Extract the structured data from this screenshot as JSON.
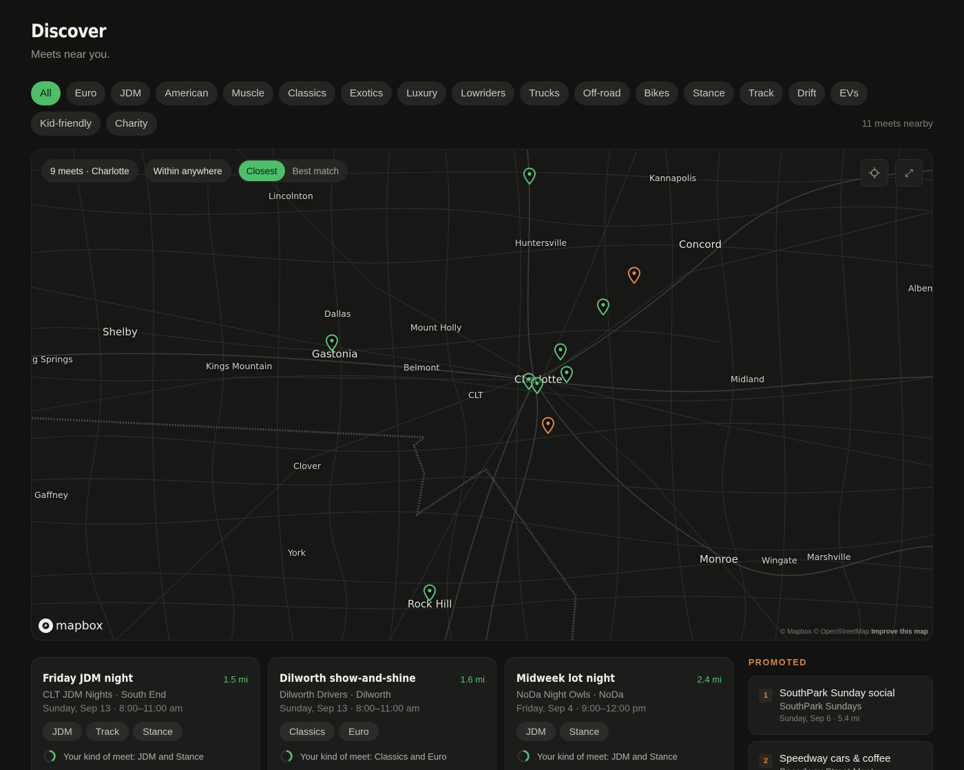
{
  "header": {
    "title": "Discover",
    "subtitle": "Meets near you."
  },
  "filters": {
    "row1": [
      "All",
      "Euro",
      "JDM",
      "American",
      "Muscle",
      "Classics",
      "Exotics",
      "Luxury",
      "Lowriders",
      "Trucks",
      "Off-road",
      "Bikes",
      "Stance",
      "Track",
      "Drift",
      "EVs"
    ],
    "row2": [
      "Kid-friendly",
      "Charity"
    ],
    "active": "All",
    "meets_nearby": "11 meets nearby"
  },
  "map": {
    "location_pill": "9 meets · Charlotte",
    "radius_pill": "Within anywhere",
    "sort_closest": "Closest",
    "sort_best": "Best match",
    "sort_active": "Closest",
    "locate_icon": "crosshair-icon",
    "expand_icon": "expand-icon",
    "logo_text": "mapbox",
    "attribution": "© Mapbox © OpenStreetMap",
    "attribution_link": "Improve this map",
    "colors": {
      "pin_green": "#5ac474",
      "pin_orange": "#e08a3c"
    },
    "cities": {
      "kannapolis": "Kannapolis",
      "lincolnton": "Lincolnton",
      "huntersville": "Huntersville",
      "concord": "Concord",
      "albemarle": "Albem",
      "dallas": "Dallas",
      "mount_holly": "Mount Holly",
      "shelby": "Shelby",
      "gastonia": "Gastonia",
      "boiling_springs": "g Springs",
      "kings_mountain": "Kings Mountain",
      "belmont": "Belmont",
      "charlotte": "Charlotte",
      "clt": "CLT",
      "midland": "Midland",
      "clover": "Clover",
      "gaffney": "Gaffney",
      "york": "York",
      "monroe": "Monroe",
      "wingate": "Wingate",
      "marshville": "Marshville",
      "rock_hill": "Rock Hill"
    }
  },
  "cards": [
    {
      "title": "Friday JDM night",
      "distance": "1.5 mi",
      "org": "CLT JDM Nights · South End",
      "date": "Sunday, Sep 13 · 8:00–11:00 am",
      "tags": [
        "JDM",
        "Track",
        "Stance"
      ],
      "match": "Your kind of meet: JDM and Stance"
    },
    {
      "title": "Dilworth show-and-shine",
      "distance": "1.6 mi",
      "org": "Dilworth Drivers · Dilworth",
      "date": "Sunday, Sep 13 · 8:00–11:00 am",
      "tags": [
        "Classics",
        "Euro"
      ],
      "match": "Your kind of meet: Classics and Euro"
    },
    {
      "title": "Midweek lot night",
      "distance": "2.4 mi",
      "org": "NoDa Night Owls · NoDa",
      "date": "Friday, Sep 4 · 9:00–12:00 pm",
      "tags": [
        "JDM",
        "Stance"
      ],
      "match": "Your kind of meet: JDM and Stance"
    }
  ],
  "promoted": {
    "label": "PROMOTED",
    "items": [
      {
        "rank": "1",
        "title": "SouthPark Sunday social",
        "org": "SouthPark Sundays",
        "meta": "Sunday, Sep 6 · 5.4 mi"
      },
      {
        "rank": "2",
        "title": "Speedway cars & coffee",
        "org": "Speedway Street Meet",
        "meta": ""
      }
    ]
  }
}
